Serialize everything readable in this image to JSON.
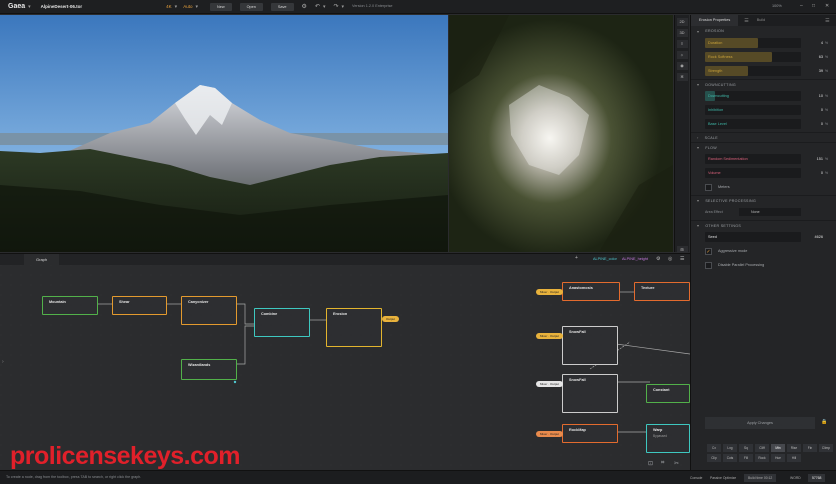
{
  "topbar": {
    "app_name": "Gaea",
    "filename": "AlpineDesert-06.tor",
    "resolution": "4K",
    "auto": "Auto",
    "buttons": [
      "New",
      "Open",
      "Save"
    ],
    "version": "Version 1.2.0 Enterprise",
    "zoom": "100%"
  },
  "viewport_tools": [
    "2D",
    "3D"
  ],
  "properties": {
    "tabs": [
      "Erosion Properties",
      "Build"
    ],
    "sections": {
      "erosion": "EROSION",
      "downcutting": "DOWNCUTTING",
      "scale": "SCALE",
      "flow": "FLOW",
      "selective": "SELECTIVE PROCESSING",
      "other": "OTHER SETTINGS"
    },
    "erosion_rows": [
      {
        "label": "Duration",
        "value": "4",
        "unit": "%",
        "fill": 0.55,
        "color": "#c9a23a"
      },
      {
        "label": "Rock Softness",
        "value": "63",
        "unit": "%",
        "fill": 0.7,
        "color": "#c9a23a"
      },
      {
        "label": "Strength",
        "value": "39",
        "unit": "%",
        "fill": 0.45,
        "color": "#c9a23a"
      }
    ],
    "downcutting_rows": [
      {
        "label": "Downcutting",
        "value": "10",
        "unit": "%",
        "fill": 0.1,
        "color": "#3fb8a8"
      },
      {
        "label": "Inhibition",
        "value": "0",
        "unit": "%",
        "fill": 0.0,
        "color": "#3fb8a8"
      },
      {
        "label": "Base Level",
        "value": "0",
        "unit": "%",
        "fill": 0.0,
        "color": "#3fb8a8"
      }
    ],
    "flow_rows": [
      {
        "label": "Random Sedimentation",
        "value": "151",
        "unit": "%",
        "fill": 0.0,
        "color": "#d9607a"
      },
      {
        "label": "Volume",
        "value": "0",
        "unit": "%",
        "fill": 0.0,
        "color": "#d9607a"
      }
    ],
    "flow_checkbox": "Meters",
    "selective_label": "Area Effect",
    "selective_value": "None",
    "seed_label": "Seed",
    "seed_value": "4626",
    "checkboxes": [
      {
        "label": "Aggressive mode",
        "checked": "✓"
      },
      {
        "label": "Disable Parallel Processing",
        "checked": ""
      }
    ],
    "apply_label": "Apply Changes",
    "small_buttons": [
      "Cx",
      "Lxg",
      "Sq",
      "Cliff",
      "Mtn",
      "Rise",
      "Fin",
      "Climp",
      "Clip",
      "Cuts",
      "Fill",
      "Rock",
      "Hue",
      "Hill"
    ]
  },
  "graph": {
    "tab": "Graph",
    "ctl_output1": "ALPINE_color",
    "ctl_output2": "ALPINE_height",
    "nodes": [
      {
        "title": "Mountain",
        "subtitle": ""
      },
      {
        "title": "Shear",
        "subtitle": ""
      },
      {
        "title": "Canyonizer",
        "subtitle": ""
      },
      {
        "title": "Combine",
        "subtitle": ""
      },
      {
        "title": "Erosion",
        "subtitle": ""
      },
      {
        "title": "Wizardlands",
        "subtitle": ""
      },
      {
        "title": "Anastomosis",
        "subtitle": ""
      },
      {
        "title": "Texture",
        "subtitle": ""
      },
      {
        "title": "SnowFall",
        "subtitle": ""
      },
      {
        "title": "SnowFall",
        "subtitle": ""
      },
      {
        "title": "Constant",
        "subtitle": ""
      },
      {
        "title": "RockMap",
        "subtitle": ""
      },
      {
        "title": "Warp",
        "subtitle": "Bypassed"
      }
    ],
    "tags": [
      "Mixer · Output",
      "Mixer · Output",
      "Mixer · Output",
      "Mixer · Output",
      "Output"
    ]
  },
  "status": {
    "hint": "To create a node, drag from the toolbox, press TAB to search, or right click the graph.",
    "items": [
      "Console",
      "Passive Optimize",
      "Build time 00:12",
      "WORD",
      "57768"
    ]
  },
  "watermark": "prolicensekeys.com"
}
